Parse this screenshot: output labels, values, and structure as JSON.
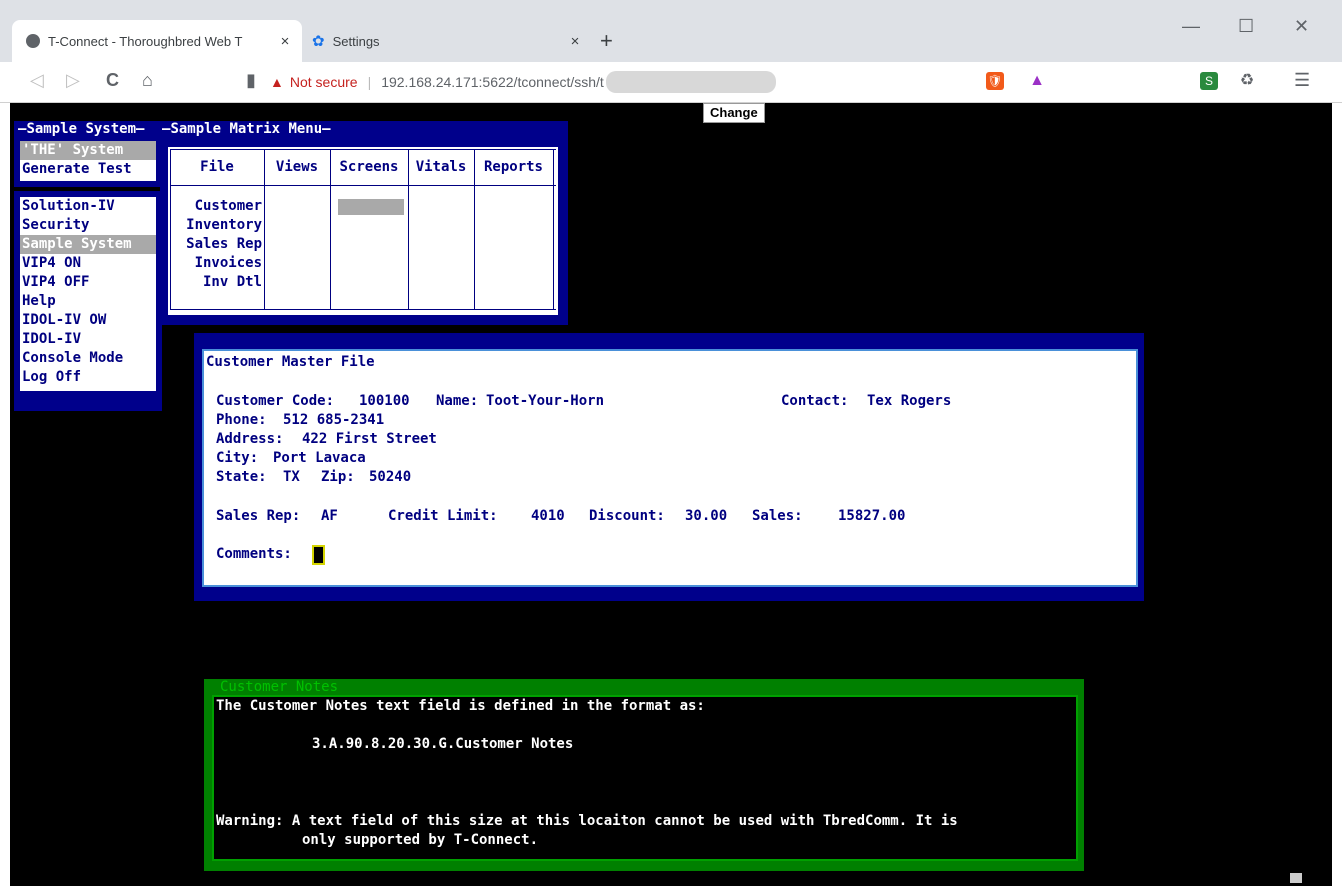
{
  "browser": {
    "tabs": [
      {
        "label": "T-Connect - Thoroughbred Web T",
        "close": "×"
      },
      {
        "label": "Settings",
        "close": "×"
      }
    ],
    "new_tab": "+",
    "window_controls": [
      "—",
      "☐",
      "✕"
    ],
    "nav": {
      "back": "◁",
      "forward": "▷",
      "reload": "C",
      "home": "⌂",
      "bookmark": "▮"
    },
    "address": {
      "warning": "▲",
      "security_label": "Not secure",
      "url": "192.168.24.171:5622/tconnect/ssh/t"
    },
    "menu_icon": "☰"
  },
  "terminal": {
    "change_button": "Change",
    "system_menu": {
      "title": "Sample System",
      "items": [
        {
          "label": "'THE' System",
          "selected": true
        },
        {
          "label": "Generate Test",
          "selected": false
        }
      ]
    },
    "main_menu": {
      "items": [
        {
          "label": "Solution-IV",
          "selected": false
        },
        {
          "label": "Security",
          "selected": false
        },
        {
          "label": "Sample System",
          "selected": true
        },
        {
          "label": "VIP4 ON",
          "selected": false
        },
        {
          "label": "VIP4 OFF",
          "selected": false
        },
        {
          "label": "Help",
          "selected": false
        },
        {
          "label": "IDOL-IV OW",
          "selected": false
        },
        {
          "label": "IDOL-IV",
          "selected": false
        },
        {
          "label": "Console Mode",
          "selected": false
        },
        {
          "label": "Log Off",
          "selected": false
        }
      ]
    },
    "matrix_menu": {
      "title": "Sample Matrix Menu",
      "columns": [
        "File",
        "Views",
        "Screens",
        "Vitals",
        "Reports"
      ],
      "rows": [
        "Customer",
        "Inventory",
        "Sales Rep",
        "Invoices",
        "Inv Dtl"
      ]
    },
    "customer": {
      "title": "Customer Master File",
      "code_label": "Customer Code:",
      "code": "100100",
      "name_label": "Name:",
      "name": "Toot-Your-Horn",
      "contact_label": "Contact:",
      "contact": "Tex Rogers",
      "phone_label": "Phone:",
      "phone": "512 685-2341",
      "address_label": "Address:",
      "address": "422 First Street",
      "city_label": "City:",
      "city": "Port Lavaca",
      "state_label": "State:",
      "state": "TX",
      "zip_label": "Zip:",
      "zip": "50240",
      "salesrep_label": "Sales Rep:",
      "salesrep": "AF",
      "credit_label": "Credit Limit:",
      "credit": "4010",
      "discount_label": "Discount:",
      "discount": "30.00",
      "sales_label": "Sales:",
      "sales": "15827.00",
      "comments_label": "Comments:"
    },
    "notes": {
      "title": "Customer Notes",
      "line1": "The Customer Notes text field is defined in the format as:",
      "line2": "3.A.90.8.20.30.G.Customer Notes",
      "line3": "Warning: A text field of this size at this locaiton cannot be used with TbredComm. It is",
      "line4": "only supported by T-Connect."
    }
  }
}
